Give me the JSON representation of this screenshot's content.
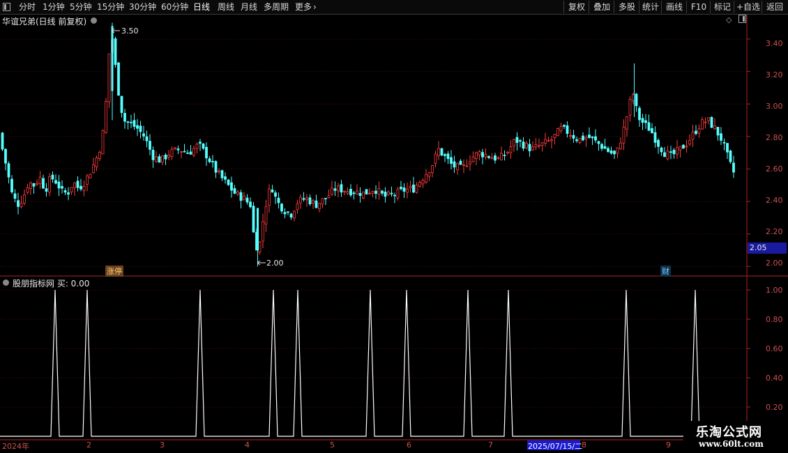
{
  "toolbar": {
    "periods": [
      "分时",
      "1分钟",
      "5分钟",
      "15分钟",
      "30分钟",
      "60分钟",
      "日线",
      "周线",
      "月线",
      "多周期",
      "更多"
    ],
    "active_period": "日线",
    "right_buttons": [
      "复权",
      "叠加",
      "多股",
      "统计",
      "画线",
      "F10",
      "标记",
      "+自选",
      "返回"
    ]
  },
  "main_pane": {
    "title": "华谊兄弟(日线 前复权)",
    "high_label": "3.50",
    "low_label": "2.00",
    "current_price_tag": "2.05",
    "marker_zhangting": "涨停",
    "marker_cai": "财"
  },
  "indicator_pane": {
    "title": "股朋指标网 买: 0.00"
  },
  "time_axis": {
    "labels": [
      "2024年",
      "2",
      "3",
      "4",
      "5",
      "6",
      "7",
      "8",
      "9"
    ],
    "cursor_date": "2025/07/15/二"
  },
  "watermark": {
    "line1": "乐淘公式网",
    "line2": "www.60lt.com"
  },
  "colors": {
    "up": "#ff3b3b",
    "down": "#54ffff",
    "axis": "#b52222",
    "indicator": "#ffffff",
    "cursor_bg": "#1a1ad0"
  },
  "chart_data": [
    {
      "type": "candlestick",
      "title": "华谊兄弟(日线 前复权)",
      "ylim": [
        1.95,
        3.55
      ],
      "yticks": [
        2.0,
        2.2,
        2.4,
        2.6,
        2.8,
        3.0,
        3.2,
        3.4
      ],
      "period_high": 3.5,
      "period_low": 2.0,
      "last_price_tag": 2.05
    },
    {
      "type": "line",
      "title": "股朋指标网 买: 0.00",
      "series": [
        {
          "name": "买",
          "values_description": "0 baseline with spikes to 1.00"
        }
      ],
      "ylim": [
        0,
        1.05
      ],
      "yticks": [
        0.2,
        0.4,
        0.6,
        0.8,
        1.0
      ],
      "spike_count": 11,
      "spike_value": 1.0
    }
  ]
}
